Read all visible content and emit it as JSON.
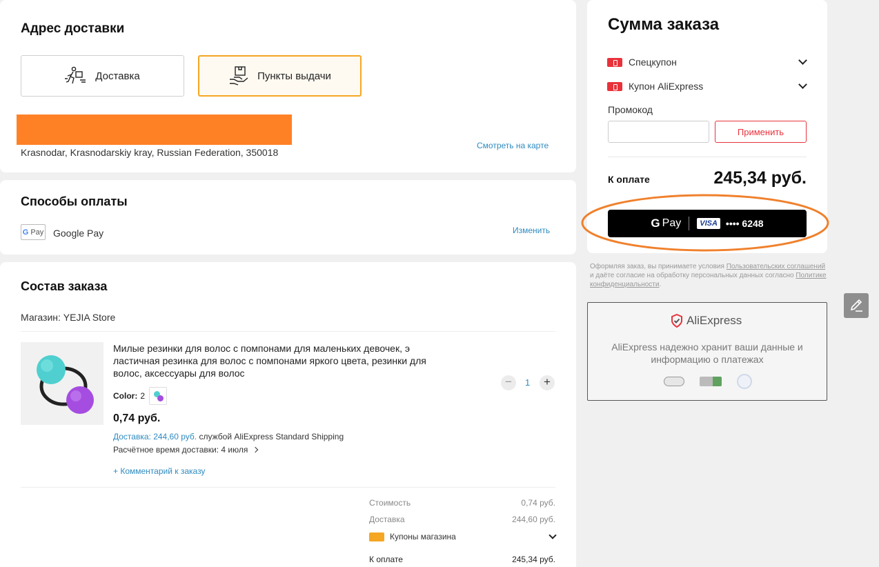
{
  "address": {
    "title": "Адрес доставки",
    "delivery_option": "Доставка",
    "pickup_option": "Пункты выдачи",
    "address_line": "Krasnodar, Krasnodarskiy kray, Russian Federation, 350018",
    "map_link": "Смотреть на карте"
  },
  "payment": {
    "title": "Способы оплаты",
    "method": "Google Pay",
    "change_link": "Изменить"
  },
  "order": {
    "title": "Состав заказа",
    "store": "Магазин: YEJIA Store",
    "item": {
      "title": "Милые резинки для волос с помпонами для маленьких девочек, э ластичная резинка для волос с помпонами яркого цвета, резинки для волос, аксессуары для волос",
      "color_label": "Color:",
      "color_value": "2",
      "price": "0,74 руб.",
      "delivery_price": "Доставка: 244,60 руб.",
      "delivery_service": "службой AliExpress Standard Shipping",
      "eta": "Расчётное время доставки: 4 июля",
      "comment_link": "+ Комментарий к заказу",
      "quantity": "1",
      "minus": "−",
      "plus": "+"
    },
    "summary": {
      "cost_label": "Стоимость",
      "cost_value": "0,74 руб.",
      "delivery_label": "Доставка",
      "delivery_value": "244,60 руб.",
      "coupons_label": "Купоны магазина",
      "total_label": "К оплате",
      "total_value": "245,34 руб."
    }
  },
  "sidebar": {
    "title": "Сумма заказа",
    "special_coupon": "Спецкупон",
    "ali_coupon": "Купон AliExpress",
    "promo_label": "Промокод",
    "promo_placeholder": "",
    "apply_button": "Применить",
    "total_label": "К оплате",
    "total_value": "245,34 руб.",
    "pay_button": {
      "gpay": "Pay",
      "card_brand": "VISA",
      "card_number": "•••• 6248"
    },
    "terms": {
      "part1": "Оформляя заказ, вы принимаете условия ",
      "link1": "Пользовательских соглашений",
      "part2": " и даёте согласие на обработку персональных данных согласно ",
      "link2": "Политике конфиденциальности",
      "part3": "."
    },
    "security": {
      "brand": "AliExpress",
      "text": "AliExpress надежно хранит ваши данные и информацию о платежах"
    }
  },
  "colors": {
    "accent": "#f5a623",
    "link": "#2e8bc0",
    "red": "#e8323b",
    "redacted": "#ff8126",
    "highlight_ellipse": "#f0802c"
  }
}
